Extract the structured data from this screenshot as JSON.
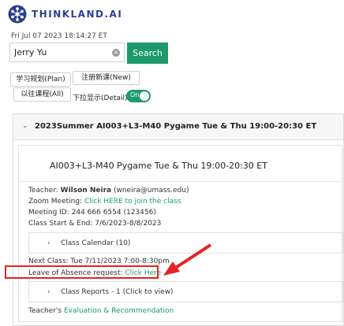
{
  "brand": {
    "logo_text": "THINKLAND.AI"
  },
  "timestamp": "Fri Jul 07 2023 18:14:27 ET",
  "search": {
    "value": "Jerry Yu",
    "button": "Search"
  },
  "buttons": {
    "plan": "学习规划(Plan)",
    "new": "注册新课(New)",
    "all": "以往课程(All)"
  },
  "toggle": {
    "label": "下拉显示(Detail)",
    "state": "On"
  },
  "panel": {
    "title": "2023Summer AI003+L3-M40 Pygame Tue & Thu 19:00-20:30 ET",
    "class_title": "AI003+L3-M40 Pygame Tue & Thu 19:00-20:30 ET",
    "teacher_label": "Teacher:",
    "teacher_name": "Wilson Neira",
    "teacher_email": "(wneira@umass.edu)",
    "zoom_label": "Zoom Meeting:",
    "zoom_link": "Click HERE to join the class",
    "meeting_id": "Meeting ID: 244 666 6554 (123456)",
    "class_dates": "Class Start & End: 7/6/2023-8/8/2023",
    "calendar": "Class Calendar (10)",
    "next_class": "Next Class: Tue 7/11/2023 7:00-8:30pm",
    "leave_label": "Leave of Absence request:",
    "leave_link": "Click Here",
    "reports": "Class Reports - 1 (Click to view)",
    "eval_label": "Teacher's",
    "eval_link": "Evaluation & Recommendation"
  },
  "colors": {
    "accent": "#1d9a6c",
    "highlight": "#e62222",
    "brand": "#2b3f8f"
  }
}
